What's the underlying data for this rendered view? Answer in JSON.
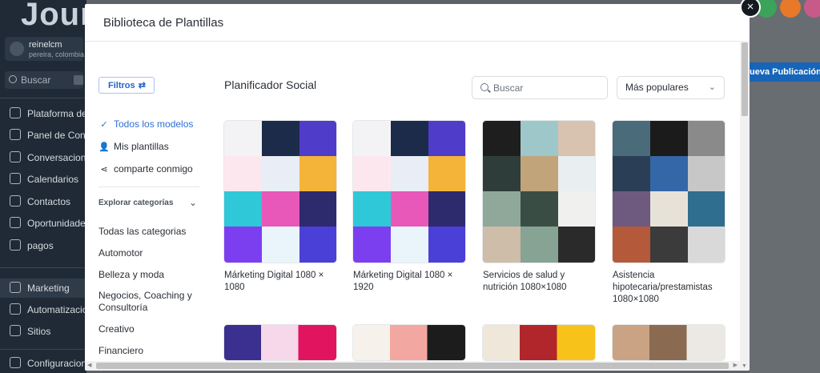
{
  "background_app": {
    "logo": "Jour",
    "user": {
      "name": "reinelcm",
      "location": "pereira, colombia"
    },
    "search_placeholder": "Buscar",
    "sidebar_items": [
      {
        "label": "Plataforma de"
      },
      {
        "label": "Panel de Contr"
      },
      {
        "label": "Conversacione"
      },
      {
        "label": "Calendarios"
      },
      {
        "label": "Contactos"
      },
      {
        "label": "Oportunidades"
      },
      {
        "label": "pagos"
      },
      {
        "label": "Marketing"
      },
      {
        "label": "Automatizacio"
      },
      {
        "label": "Sitios"
      },
      {
        "label": "Configuracion"
      }
    ],
    "publish_button": "ueva Publicación"
  },
  "modal": {
    "title": "Biblioteca de Plantillas",
    "filters_button": "Filtros",
    "filters_icon": "⇄",
    "close_icon": "×",
    "options": [
      {
        "label": "Todos los modelos",
        "icon": "check-circle-icon",
        "glyph": "✓",
        "selected": true
      },
      {
        "label": "Mis plantillas",
        "icon": "user-icon",
        "glyph": "👤",
        "selected": false
      },
      {
        "label": "comparte conmigo",
        "icon": "share-icon",
        "glyph": "⋖",
        "selected": false
      }
    ],
    "explore_label": "Explorar categorías",
    "explore_chevron": "⌄",
    "categories": [
      "Todas las categorias",
      "Automotor",
      "Belleza y moda",
      "Negocios, Coaching y Consultoría",
      "Creativo",
      "Financiero"
    ],
    "section_title": "Planificador Social",
    "search_placeholder": "Buscar",
    "sort_selected": "Más populares",
    "sort_chevron": "⌄",
    "templates": [
      {
        "label": "Márketing Digital 1080 × 1080"
      },
      {
        "label": "Márketing Digital 1080 × 1920"
      },
      {
        "label": "Servicios de salud y nutrición 1080×1080"
      },
      {
        "label": "Asistencia hipotecaria/prestamistas 1080×1080"
      }
    ]
  },
  "colors": {
    "accent": "#2d6fd6",
    "sidebar_bg": "#1f2a36",
    "publish_bg": "#1665b8"
  }
}
